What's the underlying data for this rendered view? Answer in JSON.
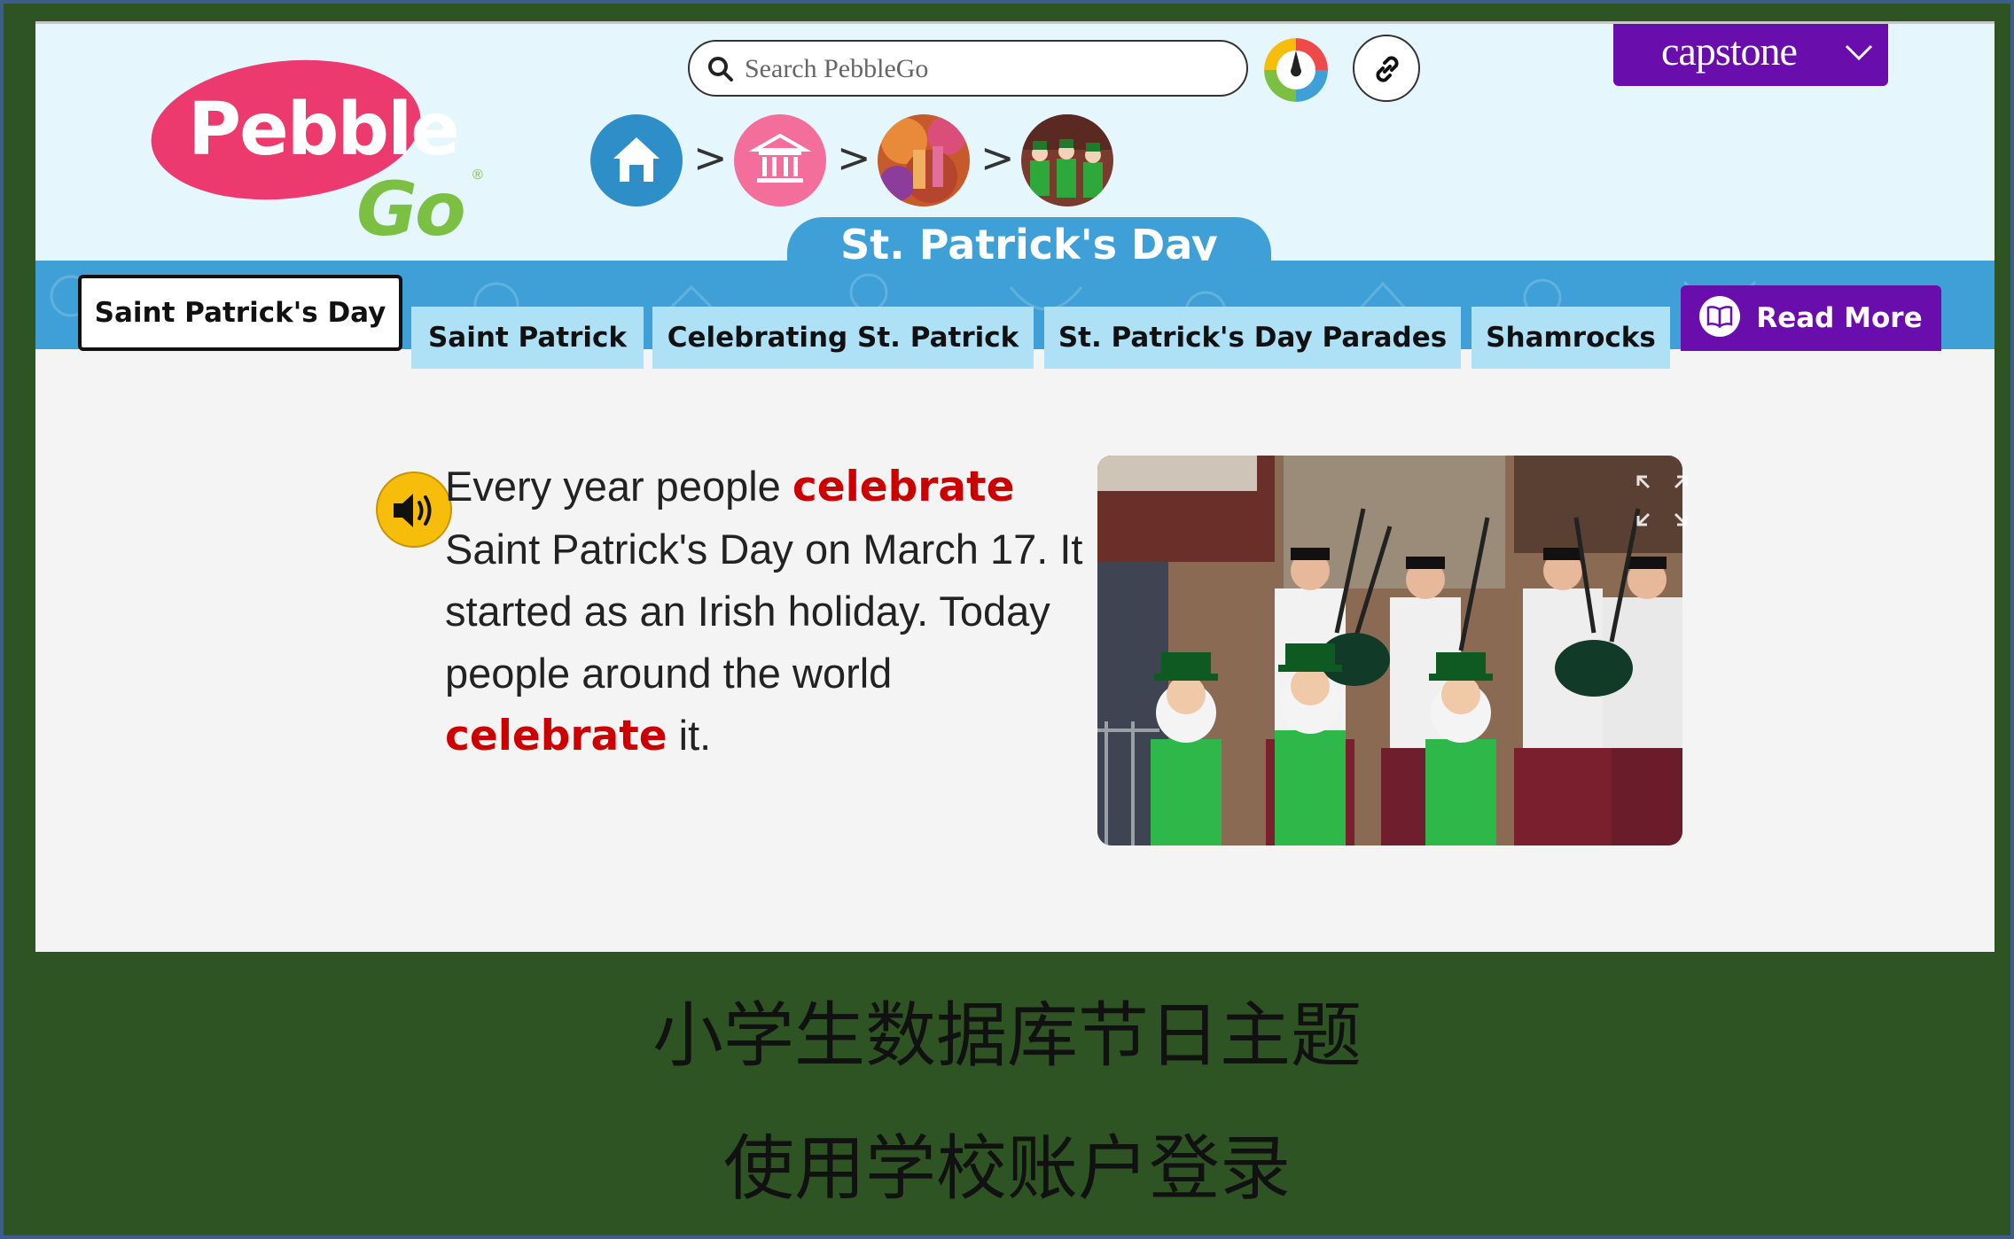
{
  "search": {
    "placeholder": "Search PebbleGo"
  },
  "brand": {
    "logo_text_1": "Pebble",
    "logo_text_2": "Go",
    "logo_reg": "®",
    "capstone_label": "capstone"
  },
  "breadcrumb": {
    "items": [
      "home-icon",
      "museum-icon",
      "holi-thumbnail",
      "parade-thumbnail"
    ],
    "separator": ">"
  },
  "topic_title": "St. Patrick's Day",
  "tabs": [
    {
      "label": "Saint Patrick's Day",
      "active": true
    },
    {
      "label": "Saint Patrick",
      "active": false
    },
    {
      "label": "Celebrating St. Patrick",
      "active": false
    },
    {
      "label": "St. Patrick's Day Parades",
      "active": false
    },
    {
      "label": "Shamrocks",
      "active": false
    },
    {
      "label": "Read More",
      "active": false,
      "icon": "book-icon"
    }
  ],
  "article": {
    "seg1": "Every year people ",
    "kw1": "celebrate",
    "seg2": " Saint Patrick's Day on March 17. It started as an Irish holiday. Today people around the world ",
    "kw2": "celebrate",
    "seg3": " it."
  },
  "caption": {
    "line1": "小学生数据库节日主题",
    "line2": "使用学校账户登录"
  },
  "colors": {
    "brand_purple": "#6a0dad",
    "nav_blue": "#3ea0d6",
    "keyword_red": "#cc0000",
    "logo_pink": "#ec3a6e",
    "logo_green": "#7bc043"
  }
}
